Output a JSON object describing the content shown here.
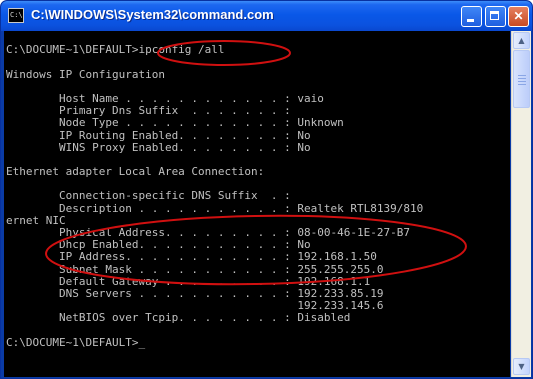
{
  "window": {
    "title": "C:\\WINDOWS\\System32\\command.com",
    "icon_label": "C:\\"
  },
  "controls": {
    "minimize_icon": "minimize-icon",
    "maximize_icon": "maximize-icon",
    "close_label": "✕"
  },
  "console": {
    "lines": [
      "",
      "C:\\DOCUME~1\\DEFAULT>ipconfig /all",
      "",
      "Windows IP Configuration",
      "",
      "        Host Name . . . . . . . . . . . . : vaio",
      "        Primary Dns Suffix  . . . . . . . :",
      "        Node Type . . . . . . . . . . . . : Unknown",
      "        IP Routing Enabled. . . . . . . . : No",
      "        WINS Proxy Enabled. . . . . . . . : No",
      "",
      "Ethernet adapter Local Area Connection:",
      "",
      "        Connection-specific DNS Suffix  . :",
      "        Description . . . . . . . . . . . : Realtek RTL8139/810",
      "ernet NIC",
      "        Physical Address. . . . . . . . . : 08-00-46-1E-27-B7",
      "        Dhcp Enabled. . . . . . . . . . . : No",
      "        IP Address. . . . . . . . . . . . : 192.168.1.50",
      "        Subnet Mask . . . . . . . . . . . : 255.255.255.0",
      "        Default Gateway . . . . . . . . . : 192.168.1.1",
      "        DNS Servers . . . . . . . . . . . : 192.233.85.19",
      "                                            192.233.145.6",
      "        NetBIOS over Tcpip. . . . . . . . : Disabled",
      "",
      "C:\\DOCUME~1\\DEFAULT>"
    ],
    "cursor": "_",
    "text_color": "#c0c0c0",
    "background_color": "#000000"
  },
  "annotations": {
    "color": "#d01010",
    "highlighted": [
      "command",
      "network-settings"
    ]
  },
  "scrollbar": {
    "up_icon": "scroll-up-arrow-icon",
    "down_icon": "scroll-down-arrow-icon"
  }
}
